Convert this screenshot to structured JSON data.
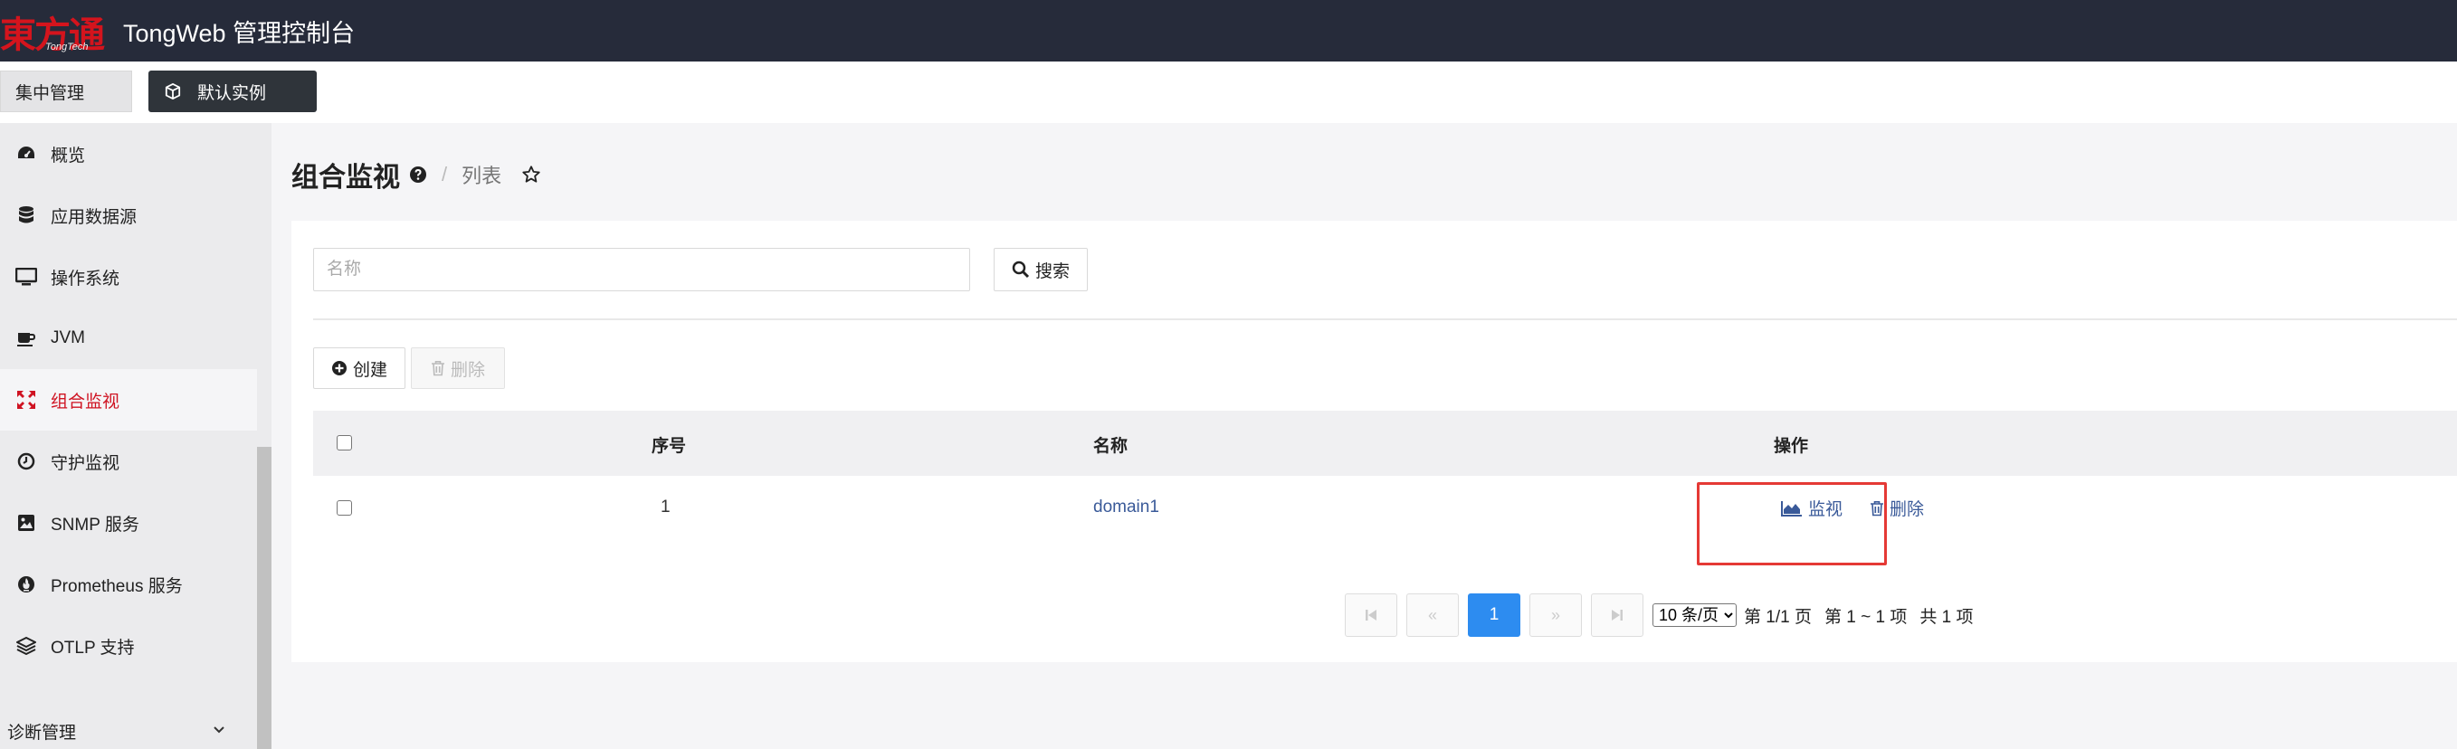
{
  "header": {
    "logo_cn": "東方通",
    "logo_en": "TongTech",
    "app_title": "TongWeb 管理控制台"
  },
  "subbar": {
    "central_label": "集中管理",
    "instance_label": "默认实例"
  },
  "sidebar": {
    "items": [
      {
        "label": "概览",
        "icon": "dashboard-icon"
      },
      {
        "label": "应用数据源",
        "icon": "database-icon"
      },
      {
        "label": "操作系统",
        "icon": "monitor-icon"
      },
      {
        "label": "JVM",
        "icon": "coffee-icon"
      },
      {
        "label": "组合监视",
        "icon": "expand-arrows-icon",
        "active": true
      },
      {
        "label": "守护监视",
        "icon": "clock-icon"
      },
      {
        "label": "SNMP 服务",
        "icon": "image-icon"
      },
      {
        "label": "Prometheus 服务",
        "icon": "fire-icon"
      },
      {
        "label": "OTLP 支持",
        "icon": "layers-icon"
      }
    ],
    "group_label": "诊断管理"
  },
  "page": {
    "title": "组合监视",
    "breadcrumb_sep": "/",
    "breadcrumb": "列表"
  },
  "search": {
    "placeholder": "名称",
    "value": "",
    "button_label": "搜索"
  },
  "toolbar": {
    "create_label": "创建",
    "delete_label": "删除"
  },
  "table": {
    "headers": [
      "序号",
      "名称",
      "操作"
    ],
    "rows": [
      {
        "index": "1",
        "name": "domain1",
        "actions": [
          "监视",
          "删除"
        ]
      }
    ]
  },
  "pagination": {
    "first": "⏮",
    "prev": "«",
    "current": "1",
    "next": "»",
    "last": "⏭",
    "page_size": "10 条/页",
    "page_info": "第 1/1 页",
    "range_info": "第 1 ~ 1 项",
    "total_info": "共 1 项"
  },
  "colors": {
    "header_bg": "#262b3a",
    "active_red": "#cf1322",
    "link_blue": "#3a5a99",
    "page_blue": "#2d8cf0",
    "highlight_red": "#e53935"
  }
}
